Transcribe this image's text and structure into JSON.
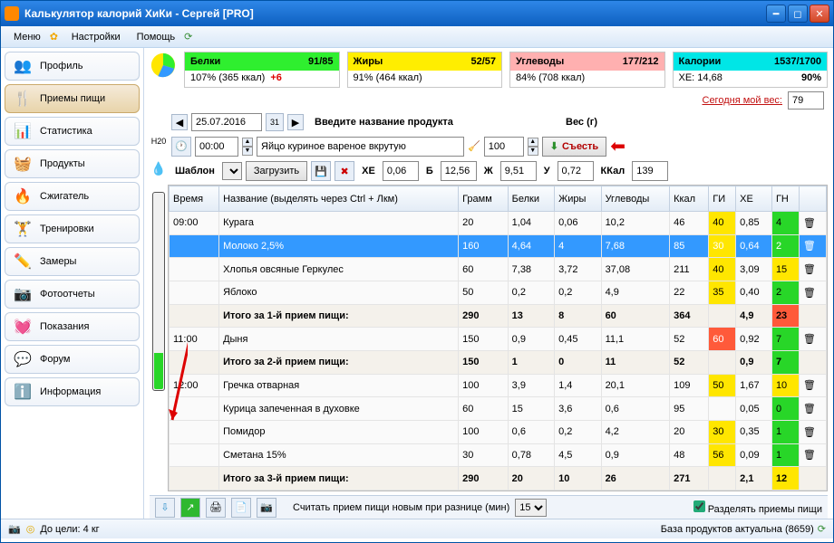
{
  "title": "Калькулятор калорий ХиКи - Сергей [PRO]",
  "menu": {
    "menu": "Меню",
    "settings": "Настройки",
    "help": "Помощь"
  },
  "sidebar": [
    {
      "label": "Профиль",
      "icon": "👥"
    },
    {
      "label": "Приемы пищи",
      "icon": "🍴",
      "active": true
    },
    {
      "label": "Статистика",
      "icon": "📊"
    },
    {
      "label": "Продукты",
      "icon": "🧺"
    },
    {
      "label": "Сжигатель",
      "icon": "🔥"
    },
    {
      "label": "Тренировки",
      "icon": "🏋️"
    },
    {
      "label": "Замеры",
      "icon": "✏️"
    },
    {
      "label": "Фотоотчеты",
      "icon": "📷"
    },
    {
      "label": "Показания",
      "icon": "💓"
    },
    {
      "label": "Форум",
      "icon": "💬"
    },
    {
      "label": "Информация",
      "icon": "ℹ️"
    }
  ],
  "nutrition": {
    "protein": {
      "label": "Белки",
      "val": "91/85",
      "sub": "107% (365 ккал)",
      "extra": "+6"
    },
    "fat": {
      "label": "Жиры",
      "val": "52/57",
      "sub": "91% (464 ккал)"
    },
    "carbs": {
      "label": "Углеводы",
      "val": "177/212",
      "sub": "84% (708 ккал)"
    },
    "cal": {
      "label": "Калории",
      "val": "1537/1700",
      "sub": "ХЕ: 14,68",
      "pct": "90%"
    }
  },
  "weight": {
    "label": "Сегодня мой вес:",
    "value": "79"
  },
  "date": "25.07.2016",
  "entry": {
    "headerProduct": "Введите название продукта",
    "headerWeight": "Вес (г)",
    "time": "00:00",
    "product": "Яйцо куриное вареное вкрутую",
    "weight": "100",
    "eat": "Съесть"
  },
  "template": {
    "h20": "H20",
    "label": "Шаблон",
    "load": "Загрузить",
    "xe": "ХЕ",
    "xev": "0,06",
    "b": "Б",
    "bv": "12,56",
    "zh": "Ж",
    "zhv": "9,51",
    "u": "У",
    "uv": "0,72",
    "kk": "ККал",
    "kkv": "139"
  },
  "columns": [
    "Время",
    "Название (выделять через Ctrl + Лкм)",
    "Грамм",
    "Белки",
    "Жиры",
    "Углеводы",
    "Ккал",
    "ГИ",
    "ХЕ",
    "ГН",
    ""
  ],
  "rows": [
    {
      "time": "09:00",
      "name": "Курага",
      "g": "20",
      "p": "1,04",
      "f": "0,06",
      "c": "10,2",
      "k": "46",
      "gi": "40",
      "gic": "gi40",
      "xe": "0,85",
      "gn": "4",
      "gnc": "gn-g"
    },
    {
      "time": "",
      "name": "Молоко 2,5%",
      "g": "160",
      "p": "4,64",
      "f": "4",
      "c": "7,68",
      "k": "85",
      "gi": "30",
      "gic": "gi30",
      "xe": "0,64",
      "gn": "2",
      "gnc": "gn-g",
      "sel": true
    },
    {
      "time": "",
      "name": "Хлопья овсяные Геркулес",
      "g": "60",
      "p": "7,38",
      "f": "3,72",
      "c": "37,08",
      "k": "211",
      "gi": "40",
      "gic": "gi40",
      "xe": "3,09",
      "gn": "15",
      "gnc": "gn-y"
    },
    {
      "time": "",
      "name": "Яблоко",
      "g": "50",
      "p": "0,2",
      "f": "0,2",
      "c": "4,9",
      "k": "22",
      "gi": "35",
      "gic": "gi35",
      "xe": "0,40",
      "gn": "2",
      "gnc": "gn-g"
    },
    {
      "total": true,
      "name": "Итого за 1-й прием пищи:",
      "g": "290",
      "p": "13",
      "f": "8",
      "c": "60",
      "k": "364",
      "gi": "",
      "xe": "4,9",
      "gn": "23",
      "gnc": "gn-r"
    },
    {
      "time": "11:00",
      "name": "Дыня",
      "g": "150",
      "p": "0,9",
      "f": "0,45",
      "c": "11,1",
      "k": "52",
      "gi": "60",
      "gic": "gi60",
      "xe": "0,92",
      "gn": "7",
      "gnc": "gn-g"
    },
    {
      "total": true,
      "name": "Итого за 2-й прием пищи:",
      "g": "150",
      "p": "1",
      "f": "0",
      "c": "11",
      "k": "52",
      "gi": "",
      "xe": "0,9",
      "gn": "7",
      "gnc": "gn-g"
    },
    {
      "time": "12:00",
      "name": "Гречка отварная",
      "g": "100",
      "p": "3,9",
      "f": "1,4",
      "c": "20,1",
      "k": "109",
      "gi": "50",
      "gic": "gi50",
      "xe": "1,67",
      "gn": "10",
      "gnc": "gn-y"
    },
    {
      "time": "",
      "name": "Курица запеченная в духовке",
      "g": "60",
      "p": "15",
      "f": "3,6",
      "c": "0,6",
      "k": "95",
      "gi": "",
      "xe": "0,05",
      "gn": "0",
      "gnc": "gn-g"
    },
    {
      "time": "",
      "name": "Помидор",
      "g": "100",
      "p": "0,6",
      "f": "0,2",
      "c": "4,2",
      "k": "20",
      "gi": "30",
      "gic": "gi30",
      "xe": "0,35",
      "gn": "1",
      "gnc": "gn-g"
    },
    {
      "time": "",
      "name": "Сметана 15%",
      "g": "30",
      "p": "0,78",
      "f": "4,5",
      "c": "0,9",
      "k": "48",
      "gi": "56",
      "gic": "gi56",
      "xe": "0,09",
      "gn": "1",
      "gnc": "gn-g"
    },
    {
      "total": true,
      "name": "Итого за 3-й прием пищи:",
      "g": "290",
      "p": "20",
      "f": "10",
      "c": "26",
      "k": "271",
      "gi": "",
      "xe": "2,1",
      "gn": "12",
      "gnc": "gn-y"
    }
  ],
  "bottom": {
    "diff": "Считать прием пищи новым при разнице (мин)",
    "diffv": "15",
    "split": "Разделять приемы пищи"
  },
  "status": {
    "goal": "До цели: 4 кг",
    "db": "База продуктов актуальна (8659)"
  }
}
